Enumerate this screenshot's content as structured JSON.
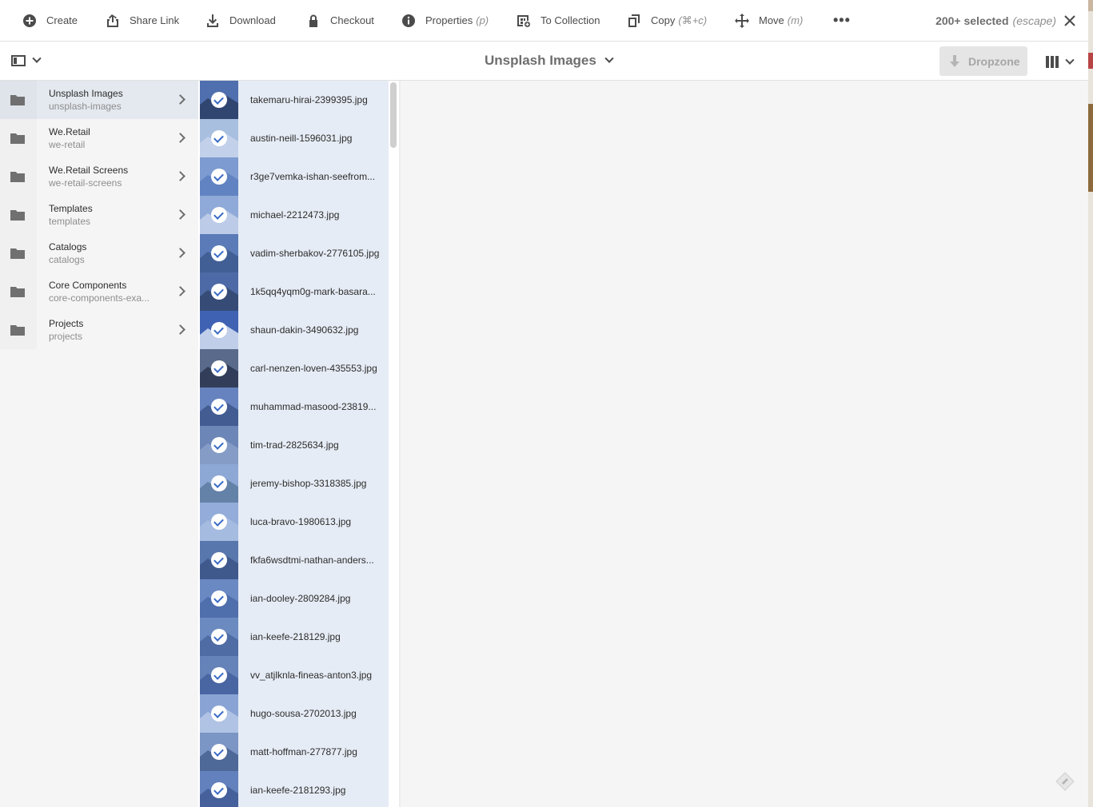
{
  "toolbar": {
    "create": "Create",
    "share_link": "Share Link",
    "download": "Download",
    "checkout": "Checkout",
    "properties": "Properties",
    "properties_key": "(p)",
    "to_collection": "To Collection",
    "copy": "Copy",
    "copy_key": "(⌘+c)",
    "move": "Move",
    "move_key": "(m)",
    "more": "•••",
    "selected": "200+ selected",
    "selected_key": "(escape)"
  },
  "header": {
    "title": "Unsplash Images",
    "dropzone": "Dropzone"
  },
  "folders": [
    {
      "title": "Unsplash Images",
      "name": "unsplash-images"
    },
    {
      "title": "We.Retail",
      "name": "we-retail"
    },
    {
      "title": "We.Retail Screens",
      "name": "we-retail-screens"
    },
    {
      "title": "Templates",
      "name": "templates"
    },
    {
      "title": "Catalogs",
      "name": "catalogs"
    },
    {
      "title": "Core Components",
      "name": "core-components-exa..."
    },
    {
      "title": "Projects",
      "name": "projects"
    }
  ],
  "files": [
    "takemaru-hirai-2399395.jpg",
    "austin-neill-1596031.jpg",
    "r3ge7vemka-ishan-seefrom...",
    "michael-2212473.jpg",
    "vadim-sherbakov-2776105.jpg",
    "1k5qq4yqm0g-mark-basara...",
    "shaun-dakin-3490632.jpg",
    "carl-nenzen-loven-435553.jpg",
    "muhammad-masood-23819...",
    "tim-trad-2825634.jpg",
    "jeremy-bishop-3318385.jpg",
    "luca-bravo-1980613.jpg",
    "fkfa6wsdtmi-nathan-anders...",
    "ian-dooley-2809284.jpg",
    "ian-keefe-218129.jpg",
    "vv_atjlknla-fineas-anton3.jpg",
    "hugo-sousa-2702013.jpg",
    "matt-hoffman-277877.jpg",
    "ian-keefe-2181293.jpg"
  ],
  "colors": {
    "selection_tint": "#5f86c9",
    "column_bg": "#e6ecf5",
    "accent_check": "#3a6bc5"
  }
}
